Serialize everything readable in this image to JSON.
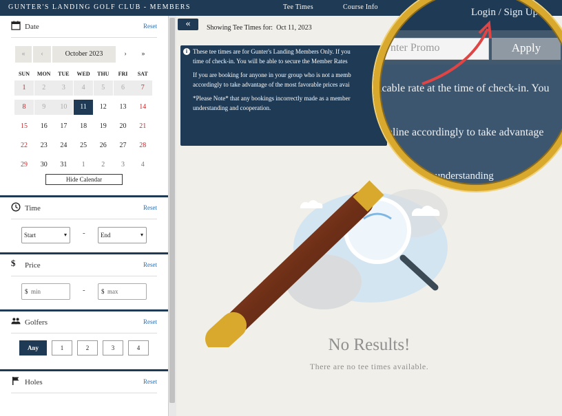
{
  "header": {
    "club_name": "GUNTER'S LANDING GOLF CLUB - MEMBERS",
    "nav": [
      "Tee Times",
      "Course Info"
    ],
    "login_label": "Login / Sign Up"
  },
  "date_section": {
    "title": "Date",
    "reset": "Reset",
    "month": "October 2023",
    "nav": {
      "first": "«",
      "prev": "‹",
      "next": "›",
      "last": "»"
    },
    "weekdays": [
      "SUN",
      "MON",
      "TUE",
      "WED",
      "THU",
      "FRI",
      "SAT"
    ],
    "weeks": [
      [
        "1",
        "2",
        "3",
        "4",
        "5",
        "6",
        "7"
      ],
      [
        "8",
        "9",
        "10",
        "11",
        "12",
        "13",
        "14"
      ],
      [
        "15",
        "16",
        "17",
        "18",
        "19",
        "20",
        "21"
      ],
      [
        "22",
        "23",
        "24",
        "25",
        "26",
        "27",
        "28"
      ],
      [
        "29",
        "30",
        "31",
        "1",
        "2",
        "3",
        "4"
      ]
    ],
    "selected": "11",
    "hide_calendar": "Hide Calendar"
  },
  "time_section": {
    "title": "Time",
    "reset": "Reset",
    "start": "Start",
    "end": "End",
    "separator": "-"
  },
  "price_section": {
    "title": "Price",
    "reset": "Reset",
    "currency": "$",
    "min_placeholder": "min",
    "max_placeholder": "max",
    "separator": "-"
  },
  "golfers_section": {
    "title": "Golfers",
    "reset": "Reset",
    "options": [
      "Any",
      "1",
      "2",
      "3",
      "4"
    ],
    "selected": "Any"
  },
  "holes_section": {
    "title": "Holes",
    "reset": "Reset"
  },
  "main": {
    "collapse_icon": "double-chevron-left",
    "showing_label": "Showing Tee Times for:",
    "showing_date": "Oct 11, 2023",
    "notice": [
      "These tee times are for Gunter's Landing Members Only.  If you",
      "time of check-in.  You will be able to secure the Member Rates",
      "If you are booking for anyone in your group who is not a memb",
      "accordingly to take advantage of the most favorable prices avai",
      "*Please Note* that any bookings incorrectly made as a member",
      "understanding and cooperation."
    ],
    "no_results_title": "No Results!",
    "no_results_sub": "There are no tee times available."
  },
  "magnified": {
    "login": "Login / Sign Up",
    "promo_placeholder": "nter Promo",
    "apply_label": "Apply",
    "line1": "icable rate at the time of check-in.  You",
    "line2": "online accordingly to take advantage",
    "line3": "our understanding"
  },
  "colors": {
    "navy": "#1f3a54",
    "link": "#2f6fb4",
    "weekend_red": "#c0282c",
    "background": "#f1efe9",
    "gold": "#d9a92d"
  }
}
